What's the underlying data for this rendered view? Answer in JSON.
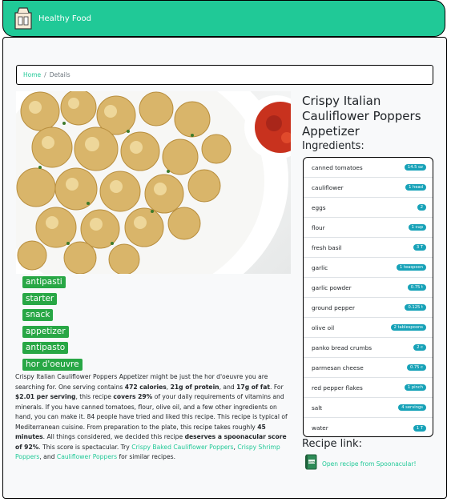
{
  "navbar": {
    "title": "Healthy Food"
  },
  "breadcrumb": {
    "home": "Home",
    "separator": "/",
    "current": "Details"
  },
  "recipe": {
    "title": "Crispy Italian Cauliflower Poppers Appetizer",
    "tags": [
      "antipasti",
      "starter",
      "snack",
      "appetizer",
      "antipasto",
      "hor d'oeuvre"
    ],
    "description": {
      "p1": "Crispy Italian Cauliflower Poppers Appetizer might be just the hor d'oeuvre you are searching for. One serving contains ",
      "calories": "472 calories",
      "sep1": ", ",
      "protein": "21g of protein",
      "sep2": ", and ",
      "fat": "17g of fat",
      "p2": ". For ",
      "price": "$2.01 per serving",
      "p3": ", this recipe ",
      "covers": "covers 29%",
      "p4": " of your daily requirements of vitamins and minerals. If you have canned tomatoes, flour, olive oil, and a few other ingredients on hand, you can make it. 84 people have tried and liked this recipe. This recipe is typical of Mediterranean cuisine. From preparation to the plate, this recipe takes roughly ",
      "time": "45 minutes",
      "p5": ". All things considered, we decided this recipe ",
      "score": "deserves a spoonacular score of 92%",
      "p6": ". This score is spectacular. Try ",
      "link1": "Crispy Baked Cauliflower Poppers",
      "sep3": ", ",
      "link2": "Crispy Shrimp Poppers",
      "sep4": ", and ",
      "link3": "Cauliflower Poppers",
      "p7": " for similar recipes."
    }
  },
  "ingredients": {
    "heading": "Ingredients:",
    "items": [
      {
        "name": "canned tomatoes",
        "amount": "14.5 oz"
      },
      {
        "name": "cauliflower",
        "amount": "1 head"
      },
      {
        "name": "eggs",
        "amount": "2"
      },
      {
        "name": "flour",
        "amount": "1 cup"
      },
      {
        "name": "fresh basil",
        "amount": "3 T"
      },
      {
        "name": "garlic",
        "amount": "1 teaspoon"
      },
      {
        "name": "garlic powder",
        "amount": "0.75 t"
      },
      {
        "name": "ground pepper",
        "amount": "0.125 t"
      },
      {
        "name": "olive oil",
        "amount": "2 tablespoons"
      },
      {
        "name": "panko bread crumbs",
        "amount": "2 c"
      },
      {
        "name": "parmesan cheese",
        "amount": "0.75 c"
      },
      {
        "name": "red pepper flakes",
        "amount": "1 pinch"
      },
      {
        "name": "salt",
        "amount": "4 servings"
      },
      {
        "name": "water",
        "amount": "1 T"
      }
    ]
  },
  "recipe_link": {
    "heading": "Recipe link:",
    "link_text": "Open recipe from Spoonacular!",
    "icon_label": "OPEN"
  },
  "colors": {
    "accent": "#20c997",
    "tag": "#28a745",
    "pill": "#17a2b8"
  },
  "icons": {
    "brand": "grocery-bag-icon",
    "link": "book-icon"
  }
}
